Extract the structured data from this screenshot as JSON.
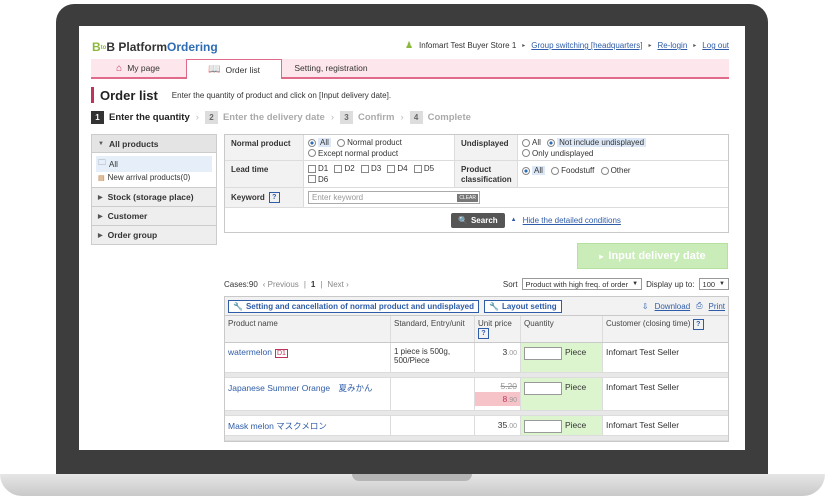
{
  "brand": {
    "b": "B",
    "to": "to",
    "b2": "B",
    "platform": "Platform",
    "ordering": "Ordering"
  },
  "user": {
    "store": "Infomart Test Buyer Store 1",
    "group_switch": "Group switching",
    "headquarters": "[headquarters]",
    "relogin": "Re-login",
    "logout": "Log out"
  },
  "tabs": [
    {
      "label": "My page"
    },
    {
      "label": "Order list"
    },
    {
      "label": "Setting, registration"
    }
  ],
  "page": {
    "title": "Order list",
    "description": "Enter the quantity of product and click on [Input delivery date]."
  },
  "steps": [
    {
      "num": "1",
      "label": "Enter the quantity"
    },
    {
      "num": "2",
      "label": "Enter the delivery date"
    },
    {
      "num": "3",
      "label": "Confirm"
    },
    {
      "num": "4",
      "label": "Complete"
    }
  ],
  "sidebar": {
    "all_products": "All products",
    "items": [
      {
        "label": "All"
      },
      {
        "label": "New arrival products(0)"
      }
    ],
    "sections": [
      {
        "label": "Stock (storage place)"
      },
      {
        "label": "Customer"
      },
      {
        "label": "Order group"
      }
    ]
  },
  "filters": {
    "normal_product_label": "Normal product",
    "normal_product_opts": [
      "All",
      "Normal product",
      "Except normal product"
    ],
    "undisplayed_label": "Undisplayed",
    "undisplayed_opts": [
      "All",
      "Not include undisplayed",
      "Only undisplayed"
    ],
    "lead_time_label": "Lead time",
    "lead_time_opts": [
      "D1",
      "D2",
      "D3",
      "D4",
      "D5",
      "D6"
    ],
    "classification_label": "Product classification",
    "classification_opts": [
      "All",
      "Foodstuff",
      "Other"
    ],
    "keyword_label": "Keyword",
    "keyword_help": "?",
    "keyword_placeholder": "Enter keyword",
    "clear": "CLEAR",
    "search": "Search",
    "hide_conditions": "Hide the detailed conditions"
  },
  "delivery_button": "Input delivery date",
  "pager": {
    "cases": "Cases:90",
    "previous": "‹ Previous",
    "page": "1",
    "next": "Next ›"
  },
  "sort": {
    "label": "Sort",
    "value": "Product with high freq. of order",
    "display_label": "Display up to:",
    "display_value": "100"
  },
  "toolbar": {
    "setting_cancel": "Setting and cancellation of normal product and undisplayed",
    "layout": "Layout setting",
    "download": "Download",
    "print": "Print"
  },
  "table": {
    "headers": {
      "product": "Product name",
      "standard": "Standard, Entry/unit",
      "unit_price": "Unit price",
      "quantity": "Quantity",
      "customer": "Customer (closing time)"
    },
    "rows": [
      {
        "name": "watermelon",
        "tag": "D1",
        "standard": "1 piece is 500g, 500/Piece",
        "price_int": "3",
        "price_dec": ".00",
        "unit": "Piece",
        "customer": "Infomart Test Seller"
      },
      {
        "name": "Japanese Summer Orange　夏みかん",
        "standard": "",
        "old_int": "5",
        "old_dec": ".20",
        "price_int": "8",
        "price_dec": ".90",
        "unit": "Piece",
        "customer": "Infomart Test Seller"
      },
      {
        "name": "Mask melon マスクメロン",
        "standard": "",
        "price_int": "35",
        "price_dec": ".00",
        "unit": "Piece",
        "customer": "Infomart Test Seller"
      }
    ]
  },
  "icons": [
    "home-icon",
    "book-icon",
    "person-icon",
    "folder-icon",
    "new-icon",
    "search-icon",
    "wrench-icon",
    "download-icon",
    "print-icon",
    "arrow-icon"
  ]
}
